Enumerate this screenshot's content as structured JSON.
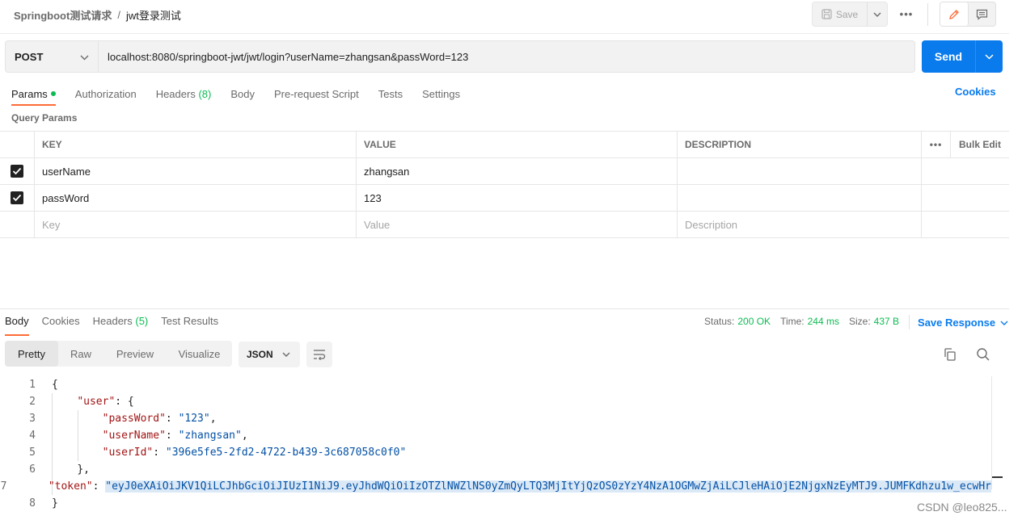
{
  "header": {
    "breadcrumb_collection": "Springboot测试请求",
    "breadcrumb_separator": "/",
    "breadcrumb_request": "jwt登录测试",
    "save_label": "Save",
    "more_label": "•••"
  },
  "request": {
    "method": "POST",
    "url": "localhost:8080/springboot-jwt/jwt/login?userName=zhangsan&passWord=123",
    "send_label": "Send"
  },
  "request_tabs": {
    "params": "Params",
    "authorization": "Authorization",
    "headers": "Headers",
    "headers_count": "(8)",
    "body": "Body",
    "prerequest": "Pre-request Script",
    "tests": "Tests",
    "settings": "Settings",
    "cookies": "Cookies"
  },
  "query_params": {
    "title": "Query Params",
    "columns": {
      "key": "KEY",
      "value": "VALUE",
      "description": "DESCRIPTION",
      "more": "•••",
      "bulk_edit": "Bulk Edit"
    },
    "rows": [
      {
        "checked": true,
        "key": "userName",
        "value": "zhangsan",
        "description": ""
      },
      {
        "checked": true,
        "key": "passWord",
        "value": "123",
        "description": ""
      }
    ],
    "placeholders": {
      "key": "Key",
      "value": "Value",
      "description": "Description"
    }
  },
  "response_tabs": {
    "body": "Body",
    "cookies": "Cookies",
    "headers": "Headers",
    "headers_count": "(5)",
    "test_results": "Test Results"
  },
  "response_meta": {
    "status_label": "Status:",
    "status_value": "200 OK",
    "time_label": "Time:",
    "time_value": "244 ms",
    "size_label": "Size:",
    "size_value": "437 B",
    "save_response": "Save Response"
  },
  "format_tabs": {
    "pretty": "Pretty",
    "raw": "Raw",
    "preview": "Preview",
    "visualize": "Visualize",
    "language": "JSON"
  },
  "code": {
    "line_numbers": [
      "1",
      "2",
      "3",
      "4",
      "5",
      "6",
      "7",
      "8"
    ],
    "l1": "{",
    "user_key": "\"user\"",
    "open_brace": ": {",
    "pw_key": "\"passWord\"",
    "pw_val": "\"123\"",
    "un_key": "\"userName\"",
    "un_val": "\"zhangsan\"",
    "id_key": "\"userId\"",
    "id_val": "\"396e5fe5-2fd2-4722-b439-3c687058c0f0\"",
    "close_inner": "},",
    "token_key": "\"token\"",
    "token_val": "\"eyJ0eXAiOiJKV1QiLCJhbGciOiJIUzI1NiJ9.eyJhdWQiOiIzOTZlNWZlNS0yZmQyLTQ3MjItYjQzOS0zYzY4NzA1OGMwZjAiLCJleHAiOjE2NjgxNzEyMTJ9.JUMFKdhzu1w_ecwHr",
    "l8": "}",
    "colon": ": ",
    "comma": ","
  },
  "watermark": "CSDN @leo825..."
}
